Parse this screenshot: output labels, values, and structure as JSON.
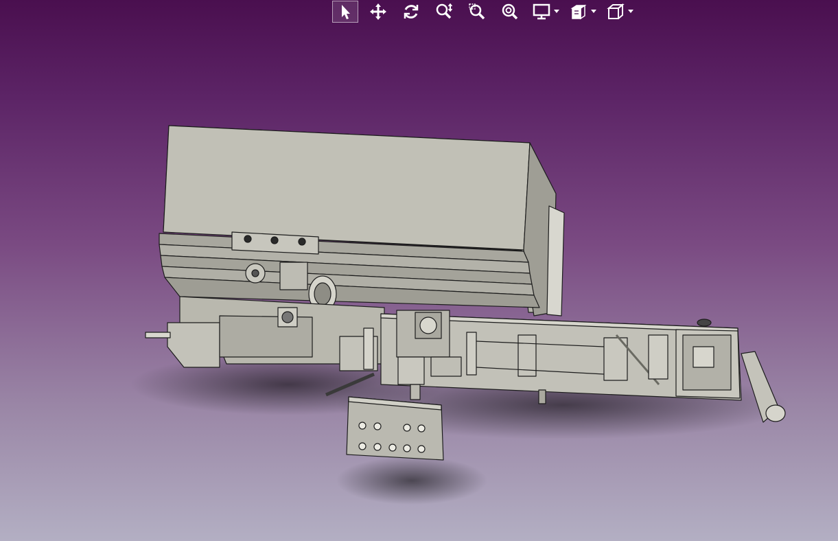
{
  "toolbar": {
    "items": [
      {
        "name": "select",
        "icon": "cursor-icon",
        "active": true
      },
      {
        "name": "pan",
        "icon": "pan-move-icon"
      },
      {
        "name": "rotate",
        "icon": "rotate-icon"
      },
      {
        "name": "zoom",
        "icon": "zoom-icon"
      },
      {
        "name": "zoom-area",
        "icon": "zoom-area-icon"
      },
      {
        "name": "zoom-fit",
        "icon": "zoom-fit-icon"
      },
      {
        "name": "display-mode",
        "icon": "monitor-icon",
        "dropdown": true
      },
      {
        "name": "view-cube",
        "icon": "view-box-icon",
        "dropdown": true
      },
      {
        "name": "box-view",
        "icon": "cube-icon",
        "dropdown": true
      }
    ]
  },
  "colors": {
    "background_top": "#4a0f4f",
    "background_bottom": "#b3afc3",
    "model_fill": "#c0bfb6",
    "model_edge": "#1c1c1c"
  }
}
